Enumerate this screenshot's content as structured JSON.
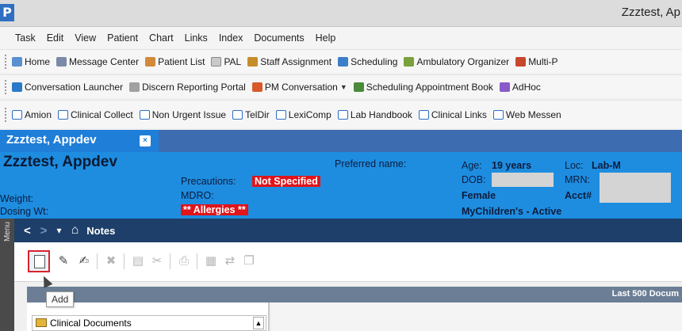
{
  "window": {
    "title": "Zzztest, Ap"
  },
  "menu": [
    "Task",
    "Edit",
    "View",
    "Patient",
    "Chart",
    "Links",
    "Index",
    "Documents",
    "Help"
  ],
  "toolbar1": [
    {
      "label": "Home",
      "icon": "home-icon"
    },
    {
      "label": "Message Center",
      "icon": "message-icon"
    },
    {
      "label": "Patient List",
      "icon": "patient-icon"
    },
    {
      "label": "PAL",
      "icon": "pal-icon"
    },
    {
      "label": "Staff Assignment",
      "icon": "staff-icon"
    },
    {
      "label": "Scheduling",
      "icon": "calendar-icon"
    },
    {
      "label": "Ambulatory Organizer",
      "icon": "organizer-icon"
    },
    {
      "label": "Multi-P",
      "icon": "multi-icon"
    }
  ],
  "toolbar2": [
    {
      "label": "Conversation Launcher",
      "icon": "conversation-icon"
    },
    {
      "label": "Discern Reporting Portal",
      "icon": "discern-icon"
    },
    {
      "label": "PM Conversation",
      "icon": "pm-icon",
      "dropdown": "▼"
    },
    {
      "label": "Scheduling Appointment Book",
      "icon": "schedule-book-icon"
    },
    {
      "label": "AdHoc",
      "icon": "adhoc-icon"
    }
  ],
  "toolbar3": [
    "Amion",
    "Clinical Collect",
    "Non Urgent Issue",
    "TelDir",
    "LexiComp",
    "Lab Handbook",
    "Clinical Links",
    "Web Messen"
  ],
  "patient_tab": {
    "label": "Zzztest, Appdev",
    "close": "×"
  },
  "banner": {
    "name": "Zzztest, Appdev",
    "preferred_name_label": "Preferred name:",
    "precautions_label": "Precautions:",
    "precautions_value": "Not Specified",
    "mdro_label": "MDRO:",
    "allergies": "** Allergies **",
    "weight_label": "Weight:",
    "dosing_label": "Dosing Wt:",
    "age_label": "Age:",
    "age_value": "19 years",
    "dob_label": "DOB:",
    "sex": "Female",
    "portal": "MyChildren's - Active",
    "loc_label": "Loc:",
    "loc_value": "Lab-M",
    "mrn_label": "MRN:",
    "acct_label": "Acct#"
  },
  "side_menu": "Menu",
  "nav": {
    "back": "<",
    "forward": ">",
    "dropdown": "▾",
    "home": "⌂",
    "title": "Notes"
  },
  "tooltip": "Add",
  "subbar_right": "Last 500 Docum",
  "tree": {
    "item": "Clinical Documents",
    "scroll_up": "▲"
  },
  "colors": {
    "banner": "#1e8de0",
    "nav": "#1d3f6a",
    "alert": "#e0141a"
  }
}
